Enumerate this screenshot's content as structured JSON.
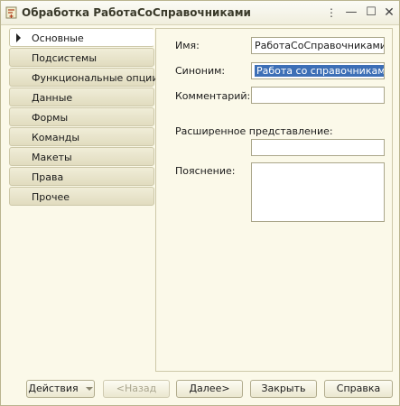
{
  "window": {
    "title": "Обработка РаботаСоСправочниками"
  },
  "tabs": [
    {
      "label": "Основные"
    },
    {
      "label": "Подсистемы"
    },
    {
      "label": "Функциональные опции"
    },
    {
      "label": "Данные"
    },
    {
      "label": "Формы"
    },
    {
      "label": "Команды"
    },
    {
      "label": "Макеты"
    },
    {
      "label": "Права"
    },
    {
      "label": "Прочее"
    }
  ],
  "form": {
    "name_label": "Имя:",
    "name_value": "РаботаСоСправочниками",
    "synonym_label": "Синоним:",
    "synonym_value": "Работа со справочниками",
    "comment_label": "Комментарий:",
    "comment_value": "",
    "extended_label": "Расширенное представление:",
    "extended_value": "",
    "explanation_label": "Пояснение:",
    "explanation_value": ""
  },
  "buttons": {
    "actions": "Действия",
    "back": "<Назад",
    "next": "Далее>",
    "close": "Закрыть",
    "help": "Справка"
  },
  "colors": {
    "background": "#fbf9e9",
    "selection": "#3d6fb6",
    "border": "#cdc8a8"
  }
}
